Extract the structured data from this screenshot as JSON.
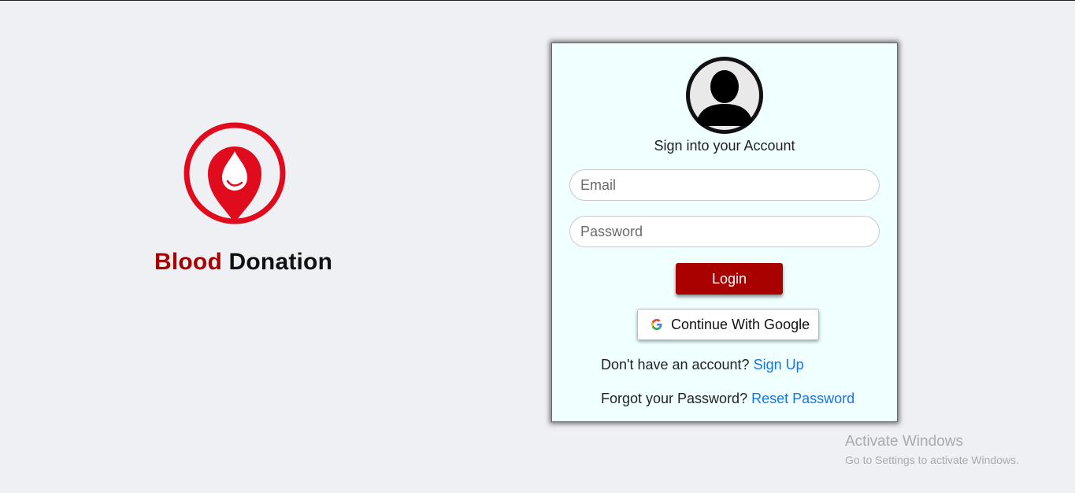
{
  "brand": {
    "title_part1": "Blood",
    "title_part2": "Donation",
    "logo_icon": "blood-drop-location-pin",
    "accent_color": "#e00b1c",
    "title_red": "#a80000"
  },
  "login_card": {
    "avatar_icon": "user-silhouette-icon",
    "heading": "Sign into your Account",
    "email_placeholder": "Email",
    "email_value": "",
    "password_placeholder": "Password",
    "password_value": "",
    "login_label": "Login",
    "google_label": "Continue With Google",
    "google_icon": "google-g-icon",
    "signup_prompt": "Don't have an account?",
    "signup_link": "Sign Up",
    "forgot_prompt": "Forgot your Password?",
    "reset_link": "Reset Password",
    "login_color": "#a90000",
    "link_color": "#1a73e8",
    "card_background": "#f0ffff"
  },
  "watermark": {
    "title": "Activate Windows",
    "subtitle": "Go to Settings to activate Windows."
  }
}
